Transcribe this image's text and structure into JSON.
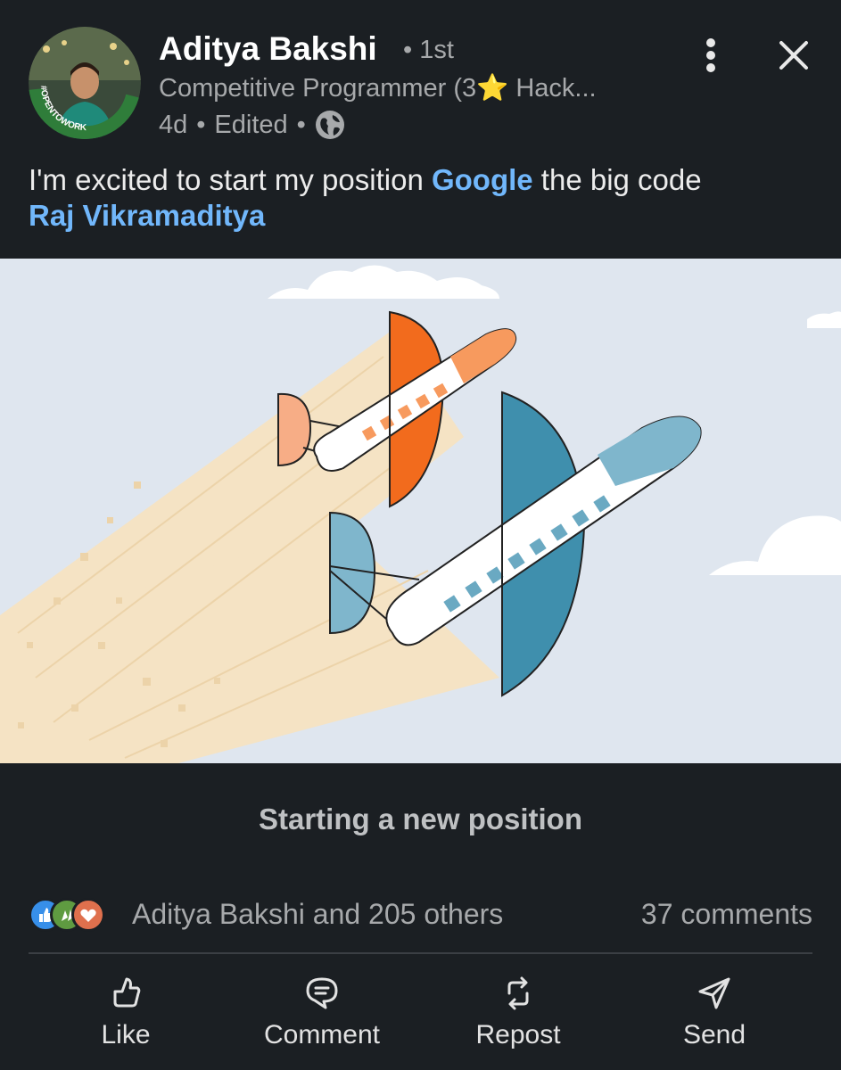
{
  "author": {
    "name": "Aditya Bakshi",
    "degree": "• 1st",
    "headline": "Competitive Programmer (3⭐ Hack...",
    "time": "4d",
    "edited": "Edited",
    "avatar_badge": "#OPENTOWORK"
  },
  "post": {
    "text_before": "I'm excited to start my position ",
    "mention_company": "Google",
    "text_after": " the big code",
    "mention_person": "Raj Vikramaditya"
  },
  "media": {
    "caption": "Starting a new position"
  },
  "social": {
    "reaction_text": "Aditya Bakshi and 205 others",
    "comments_text": "37 comments",
    "reaction_icons": [
      "like-icon",
      "celebrate-icon",
      "love-icon"
    ]
  },
  "actions": [
    {
      "label": "Like",
      "icon": "thumbs-up-icon"
    },
    {
      "label": "Comment",
      "icon": "comment-icon"
    },
    {
      "label": "Repost",
      "icon": "repost-icon"
    },
    {
      "label": "Send",
      "icon": "send-icon"
    }
  ],
  "colors": {
    "background": "#1b1f23",
    "mention": "#71b7fb",
    "open_to_work": "#2f7d3a",
    "orange_plane": "#f26b1d",
    "blue_plane": "#3f8fad"
  }
}
